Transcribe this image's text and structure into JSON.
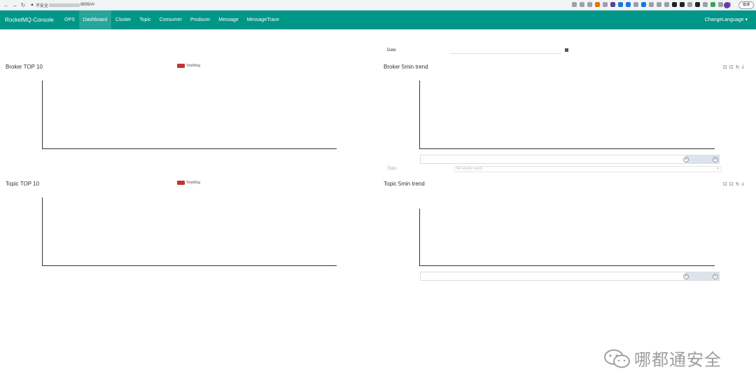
{
  "browser": {
    "security_label": "不安全",
    "url_suffix": "8899/#/",
    "update_label": "错误"
  },
  "navbar": {
    "brand": "RocketMQ-Console",
    "items": [
      "OPS",
      "Dashboard",
      "Cluster",
      "Topic",
      "Consumer",
      "Producer",
      "Message",
      "MessageTrace"
    ],
    "active": "Dashboard",
    "right": "ChangeLanguage"
  },
  "date": {
    "label": "Date",
    "value": ""
  },
  "broker_top": {
    "title": "Broker TOP 10",
    "legend": "TotalMsg"
  },
  "broker_trend": {
    "title": "Broker 5min trend"
  },
  "topic_top": {
    "title": "Topic TOP 10",
    "legend": "TotalMsg"
  },
  "topic_trend": {
    "title": "Topic 5min trend"
  },
  "topic_select": {
    "label": "Topic",
    "placeholder": "No results match"
  },
  "colors": {
    "navbar": "#009688",
    "legend": "#c23531"
  },
  "watermark": {
    "text": "哪都通安全"
  }
}
